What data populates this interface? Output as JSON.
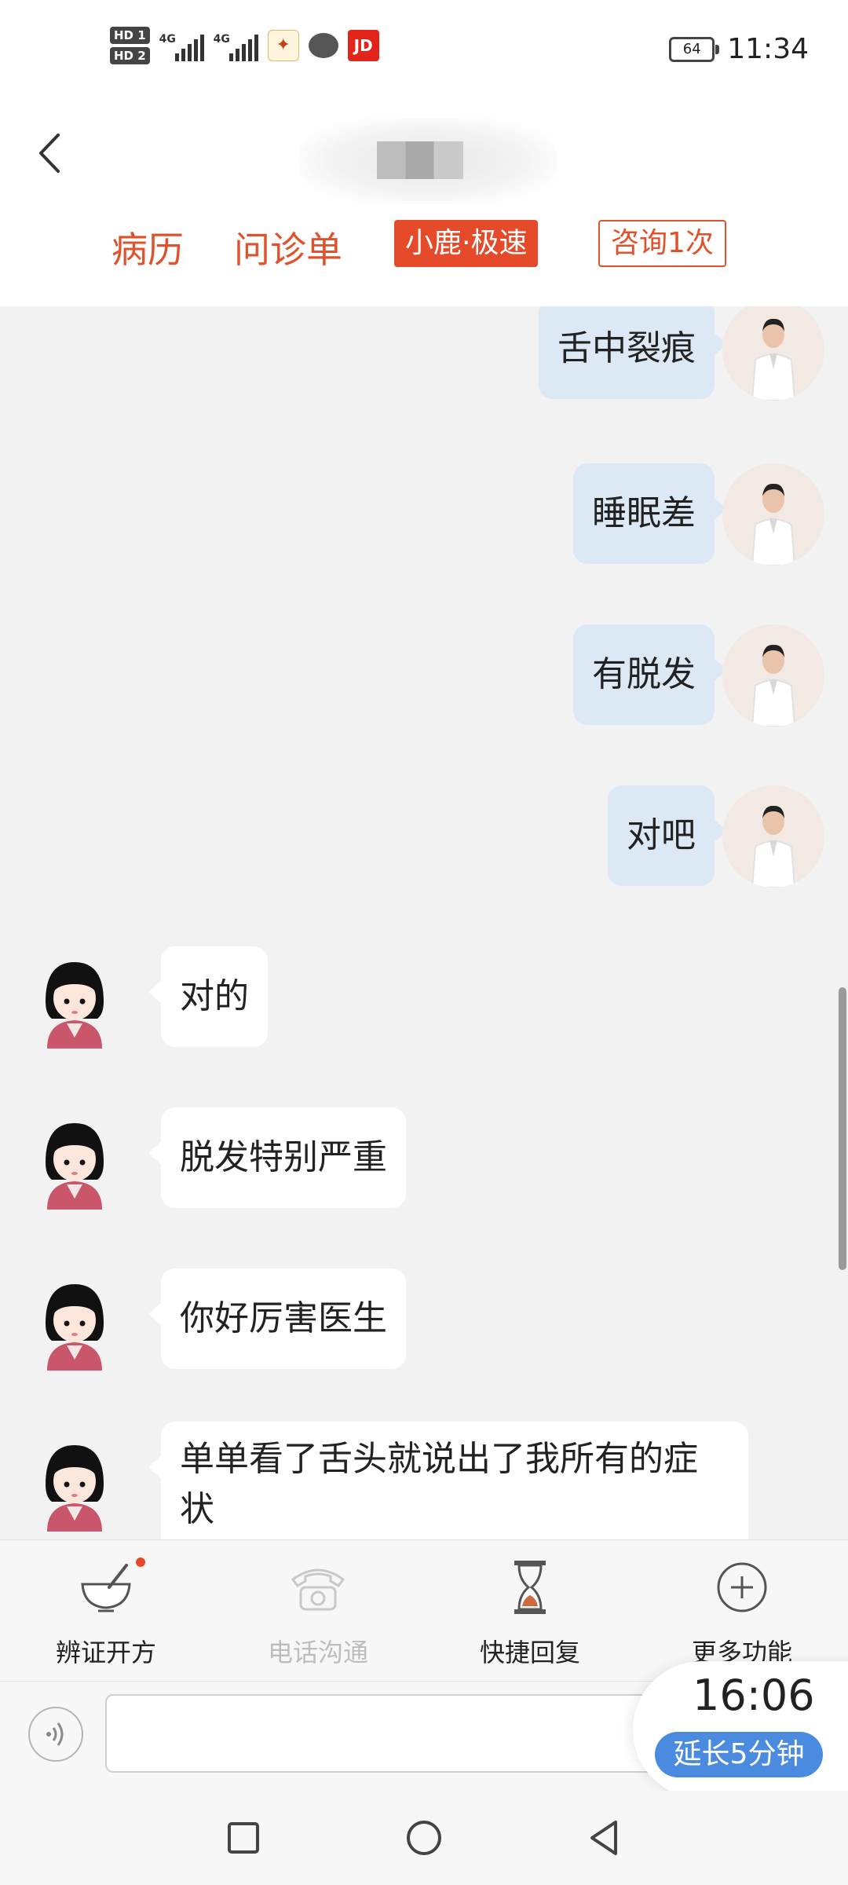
{
  "status_bar": {
    "sim1": "HD 1",
    "sim2": "HD 2",
    "net1": "4G",
    "net2": "4G",
    "app_icons": [
      "deer-app-icon",
      "chat-bubble-icon",
      "jd-app-icon"
    ],
    "jd_label": "JD",
    "battery": "64",
    "time": "11:34"
  },
  "header": {
    "title": "",
    "tabs": {
      "medical_record": "病历",
      "consult_form": "问诊单",
      "fast_tag": "小鹿·极速",
      "consult_count": "咨询1次"
    }
  },
  "messages": [
    {
      "from": "doctor",
      "text": "舌中裂痕"
    },
    {
      "from": "doctor",
      "text": "睡眠差"
    },
    {
      "from": "doctor",
      "text": "有脱发"
    },
    {
      "from": "doctor",
      "text": "对吧"
    },
    {
      "from": "patient",
      "text": "对的"
    },
    {
      "from": "patient",
      "text": "脱发特别严重"
    },
    {
      "from": "patient",
      "text": "你好厉害医生"
    },
    {
      "from": "patient",
      "text": "单单看了舌头就说出了我所有的症状"
    }
  ],
  "actions": {
    "prescribe": "辨证开方",
    "phone": "电话沟通",
    "quick_reply": "快捷回复",
    "more": "更多功能"
  },
  "input": {
    "value": "",
    "placeholder": ""
  },
  "timer": {
    "remaining": "16:06",
    "extend": "延长5分钟"
  },
  "colors": {
    "accent": "#e0522c",
    "tag_fill": "#e54a2a",
    "outgoing_bubble": "#dde8f5",
    "extend_button": "#4a8bdf"
  }
}
